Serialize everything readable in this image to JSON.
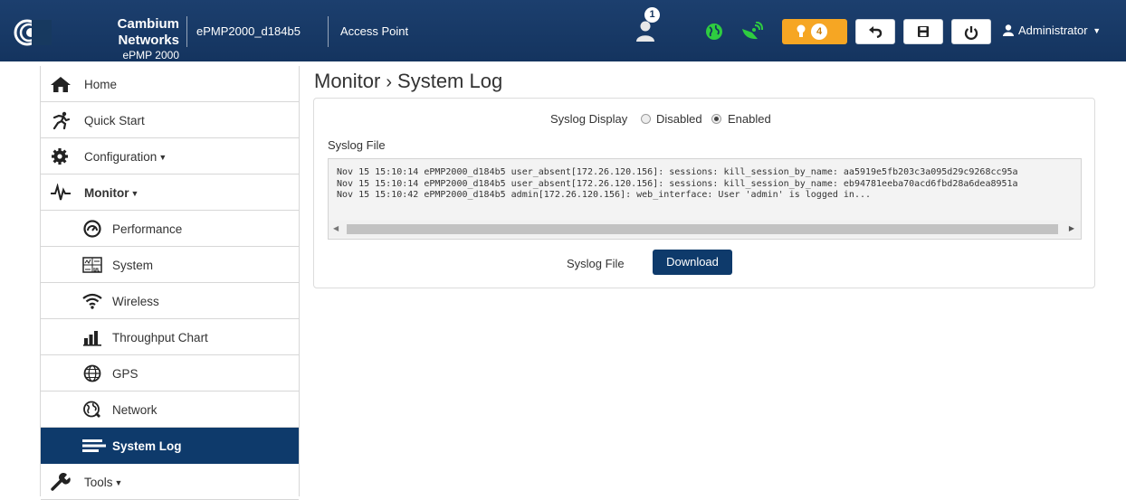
{
  "header": {
    "brand_name": "Cambium Networks",
    "brand_product": "ePMP 2000",
    "device_name": "ePMP2000_d184b5",
    "device_mode": "Access Point",
    "users_count": "1",
    "alerts_count": "4",
    "user_menu_label": "Administrator",
    "alert_color": "#f6a623",
    "status_color": "#2ecc40"
  },
  "sidebar": {
    "items": [
      {
        "label": "Home",
        "icon": "home-icon"
      },
      {
        "label": "Quick Start",
        "icon": "running-icon"
      },
      {
        "label": "Configuration",
        "icon": "gear-icon"
      },
      {
        "label": "Monitor",
        "icon": "pulse-icon"
      },
      {
        "label": "Performance",
        "icon": "gauge-icon"
      },
      {
        "label": "System",
        "icon": "system-monitor-icon"
      },
      {
        "label": "Wireless",
        "icon": "wifi-icon"
      },
      {
        "label": "Throughput Chart",
        "icon": "bar-chart-icon"
      },
      {
        "label": "GPS",
        "icon": "gps-globe-icon"
      },
      {
        "label": "Network",
        "icon": "network-globe-icon"
      },
      {
        "label": "System Log",
        "icon": "list-icon"
      },
      {
        "label": "Tools",
        "icon": "wrench-icon"
      }
    ],
    "active": "System Log",
    "active_color": "#0e3a6b"
  },
  "main": {
    "breadcrumb_parent": "Monitor",
    "breadcrumb_separator": "›",
    "breadcrumb_current": "System Log",
    "syslog_display_label": "Syslog Display",
    "radio_disabled_label": "Disabled",
    "radio_enabled_label": "Enabled",
    "syslog_display_value": "Enabled",
    "syslog_file_label": "Syslog File",
    "log_lines": [
      "Nov 15 15:10:14 ePMP2000_d184b5 user_absent[172.26.120.156]: sessions: kill_session_by_name: aa5919e5fb203c3a095d29c9268cc95a",
      "Nov 15 15:10:14 ePMP2000_d184b5 user_absent[172.26.120.156]: sessions: kill_session_by_name: eb94781eeba70acd6fbd28a6dea8951a",
      "Nov 15 15:10:42 ePMP2000_d184b5 admin[172.26.120.156]: web_interface: User 'admin' is logged in..."
    ],
    "download_row_label": "Syslog File",
    "download_button_label": "Download"
  }
}
